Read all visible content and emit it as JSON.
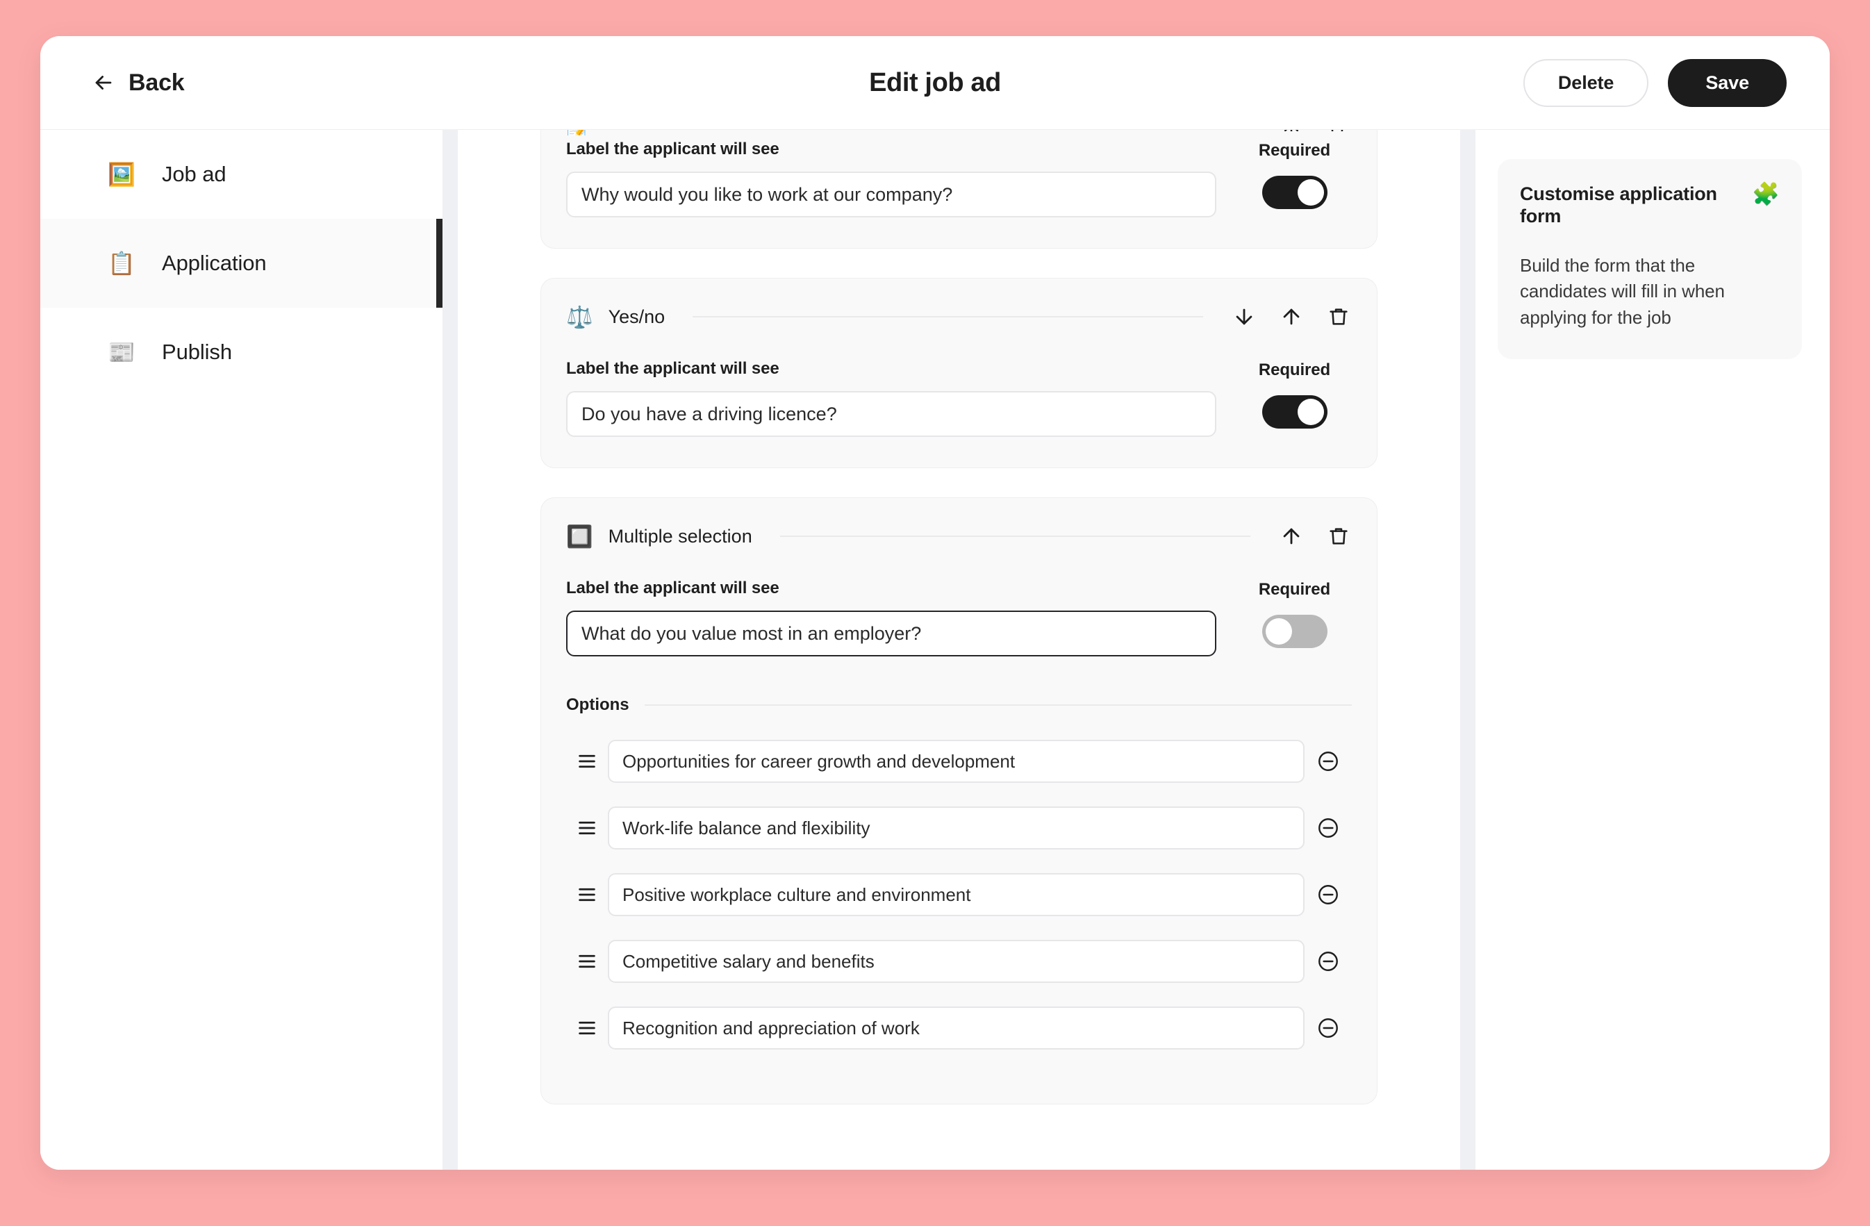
{
  "page": {
    "background_color": "#fca9a9",
    "card_background": "#ffffff"
  },
  "header": {
    "back_label": "Back",
    "back_icon": "arrow-left-icon",
    "title": "Edit job ad",
    "delete_label": "Delete",
    "save_label": "Save",
    "save_bg": "#1c1c1c"
  },
  "sidebar": {
    "items": [
      {
        "label": "Job ad",
        "emoji": "🖼️",
        "icon": "framed-picture-icon",
        "active": false
      },
      {
        "label": "Application",
        "emoji": "📋",
        "icon": "clipboard-icon",
        "active": true
      },
      {
        "label": "Publish",
        "emoji": "📰",
        "icon": "newspaper-icon",
        "active": false
      }
    ]
  },
  "main": {
    "partial_card": {
      "field_label": "Label the applicant will see",
      "input_value": "Why would you like to work at our company?",
      "required_label": "Required",
      "required_on": true,
      "clipped_emoji": "📝"
    },
    "cards": [
      {
        "type_label": "Yes/no",
        "type_emoji": "⚖️",
        "type_icon": "balance-scale-icon",
        "field_label": "Label the applicant will see",
        "input_value": "Do you have a driving licence?",
        "required_label": "Required",
        "required_on": true,
        "actions": [
          "move-down",
          "move-up",
          "delete"
        ],
        "input_focused": false,
        "options_title": null,
        "options": []
      },
      {
        "type_label": "Multiple selection",
        "type_emoji": "🔲",
        "type_icon": "checkbox-square-icon",
        "field_label": "Label the applicant will see",
        "input_value": "What do you value most in an employer?",
        "required_label": "Required",
        "required_on": false,
        "actions": [
          "move-up",
          "delete"
        ],
        "input_focused": true,
        "options_title": "Options",
        "options": [
          "Opportunities for career growth and development",
          "Work-life balance and flexibility",
          "Positive workplace culture and environment",
          "Competitive salary and benefits",
          "Recognition and appreciation of work"
        ]
      }
    ]
  },
  "right_panel": {
    "title": "Customise application form",
    "emoji": "🧩",
    "icon": "puzzle-piece-icon",
    "body": "Build the form that the candidates will fill in when applying for the job"
  }
}
